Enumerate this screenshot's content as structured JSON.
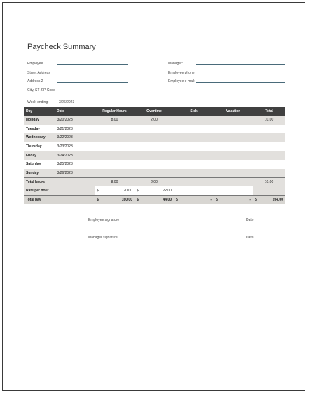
{
  "title": "Paycheck Summary",
  "fields": {
    "employee": "Employee",
    "street": "Street Address",
    "address2": "Address 2",
    "city": "City, ST  ZIP Code",
    "manager": "Manager:",
    "phone": "Employee phone:",
    "email": "Employee e-mail:",
    "week_label": "Week ending:",
    "week_value": "3/26/2023"
  },
  "table": {
    "headers": [
      "Day",
      "Date",
      "Regular Hours",
      "Overtime",
      "Sick",
      "Vacation",
      "Total"
    ],
    "rows": [
      {
        "day": "Monday",
        "date": "3/20/2023",
        "regular": "8.00",
        "overtime": "2.00",
        "sick": "",
        "vacation": "",
        "total": "10.00"
      },
      {
        "day": "Tuesday",
        "date": "3/21/2023",
        "regular": "",
        "overtime": "",
        "sick": "",
        "vacation": "",
        "total": ""
      },
      {
        "day": "Wednesday",
        "date": "3/22/2023",
        "regular": "",
        "overtime": "",
        "sick": "",
        "vacation": "",
        "total": ""
      },
      {
        "day": "Thursday",
        "date": "3/23/2023",
        "regular": "",
        "overtime": "",
        "sick": "",
        "vacation": "",
        "total": ""
      },
      {
        "day": "Friday",
        "date": "3/24/2023",
        "regular": "",
        "overtime": "",
        "sick": "",
        "vacation": "",
        "total": ""
      },
      {
        "day": "Saturday",
        "date": "3/25/2023",
        "regular": "",
        "overtime": "",
        "sick": "",
        "vacation": "",
        "total": ""
      },
      {
        "day": "Sunday",
        "date": "3/26/2023",
        "regular": "",
        "overtime": "",
        "sick": "",
        "vacation": "",
        "total": ""
      }
    ],
    "total_hours": {
      "label": "Total hours",
      "regular": "8.00",
      "overtime": "2.00",
      "total": "10.00"
    },
    "rate": {
      "label": "Rate per hour",
      "currency": "$",
      "regular": "20.00",
      "overtime": "22.00"
    },
    "total_pay": {
      "label": "Total pay",
      "currency": "$",
      "regular": "160.00",
      "overtime": "44.00",
      "sick": "-",
      "vacation": "-",
      "total": "204.00"
    }
  },
  "signatures": {
    "employee": "Employee signature",
    "manager": "Manager signature",
    "date": "Date"
  },
  "colors": {
    "header_bg": "#404040",
    "shade": "#e2e0dd",
    "line": "#4a6b7a"
  }
}
